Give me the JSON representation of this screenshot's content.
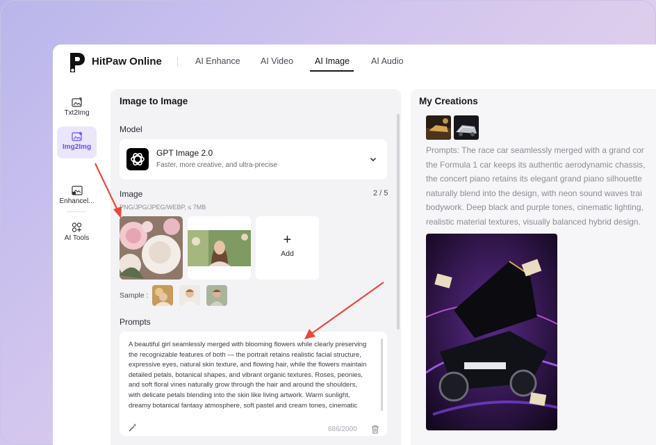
{
  "app": {
    "brand": "HitPaw Online"
  },
  "nav": {
    "tabs": [
      {
        "label": "AI Enhance",
        "active": false
      },
      {
        "label": "AI Video",
        "active": false
      },
      {
        "label": "AI Image",
        "active": true
      },
      {
        "label": "AI Audio",
        "active": false
      }
    ]
  },
  "sidebar": {
    "items": [
      {
        "label": "Txt2Img",
        "icon": "text-image-icon",
        "active": false
      },
      {
        "label": "Img2Img",
        "icon": "image-sparkle-icon",
        "active": true
      },
      {
        "label": "Enhancel...",
        "icon": "enhance-icon",
        "active": false
      },
      {
        "label": "AI Tools",
        "icon": "tools-icon",
        "active": false
      }
    ]
  },
  "editor": {
    "title": "Image to Image",
    "model": {
      "label": "Model",
      "name": "GPT Image 2.0",
      "description": "Faster, more creative, and ultra-precise"
    },
    "image": {
      "label": "Image",
      "count": "2 / 5",
      "formats": "PNG/JPG/JPEG/WEBP, ≤ 7MB",
      "add_plus": "+",
      "add_label": "Add"
    },
    "sample_label": "Sample :",
    "prompts": {
      "label": "Prompts",
      "text": "A beautiful girl seamlessly merged with blooming flowers while clearly preserving the recognizable features of both — the portrait retains realistic facial structure, expressive eyes, natural skin texture, and flowing hair, while the flowers maintain detailed petals, botanical shapes, and vibrant organic textures. Roses, peonies, and soft floral vines naturally grow through the hair and around the shoulders, with delicate petals blending into the skin like living artwork. Warm sunlight, dreamy botanical fantasy atmosphere, soft pastel and cream tones, cinematic",
      "char_count": "686/2000"
    }
  },
  "creations": {
    "title": "My Creations",
    "prompt_lines": [
      "Prompts: The race car seamlessly merged with a grand cor",
      "the Formula 1 car keeps its authentic aerodynamic chassis,",
      "the concert piano retains its elegant grand piano silhouette",
      "naturally blend into the design, with neon sound waves trai",
      "bodywork. Deep black and purple tones, cinematic lighting,",
      "realistic material textures, visually balanced hybrid design."
    ]
  },
  "colors": {
    "accent": "#6b4ef0",
    "active_bg": "#ebe6fb",
    "arrow": "#e8483a",
    "panel_bg": "#f3f3f6"
  }
}
